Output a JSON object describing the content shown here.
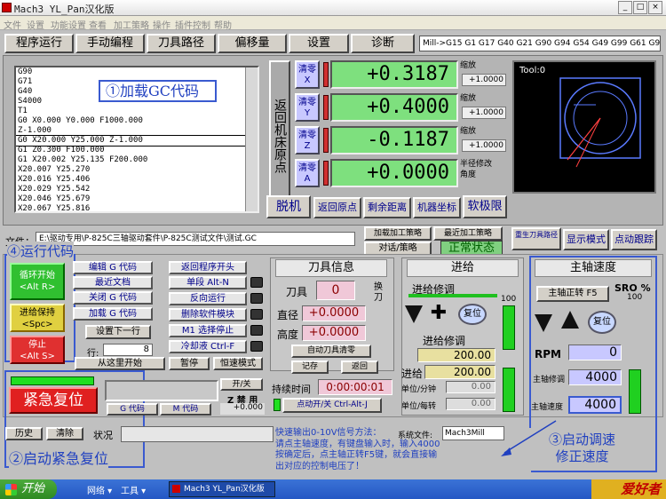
{
  "app": {
    "title": "Mach3 YL_Pan汉化版",
    "taskbar_title": "Mach3 YL_Pan汉化版"
  },
  "menu": [
    "文件",
    "设置",
    "功能设置",
    "查看",
    "加工策略",
    "操作",
    "插件控制",
    "帮助"
  ],
  "tabs": [
    "程序运行",
    "手动编程",
    "刀具路径",
    "偏移量",
    "设置",
    "诊断"
  ],
  "modal_line": "Mill->G15  G1 G17 G40 G21 G90 G94 G54 G49 G99 G61 G97",
  "gcode": [
    "G90",
    "G71",
    "G40",
    "S4000",
    "T1",
    "G0 X0.000 Y0.000 F1000.000",
    " Z-1.000",
    "G0 X20.000 Y25.000 Z-1.000",
    "G1   Z0.300 F100.000",
    "G1 X20.002 Y25.135  F200.000",
    "X20.007 Y25.270",
    "X20.016 Y25.406",
    "X20.029 Y25.542",
    "X20.046 Y25.679",
    "X20.067 Y25.816",
    "X20.091 Y25.953"
  ],
  "gcode_highlight": 7,
  "axes": [
    {
      "zero": "清零\nX",
      "value": "+0.3187",
      "scale_label": "缩放",
      "scale": "+1.0000"
    },
    {
      "zero": "清零\nY",
      "value": "+0.4000",
      "scale_label": "缩放",
      "scale": "+1.0000"
    },
    {
      "zero": "清零\nZ",
      "value": "-0.1187",
      "scale_label": "缩放",
      "scale": "+1.0000"
    },
    {
      "zero": "清零\nA",
      "value": "+0.0000",
      "scale_label": "半径修改\n角度",
      "scale": ""
    }
  ],
  "ref_all": "返回机床原点",
  "dro_buttons": [
    "脱机",
    "返回原点",
    "剩余距离",
    "机器坐标",
    "软极限"
  ],
  "toolpath": {
    "label": "Tool:0"
  },
  "file": {
    "label": "文件：",
    "path": "E:\\驱动专用\\P-825C三轴驱动套件\\P-825C测试文件\\测试.GC"
  },
  "strategy": {
    "b1": "加载加工策略",
    "b2": "最近加工策略",
    "b3": "对话/策略",
    "status": "正常状态"
  },
  "right_top": {
    "b1": "重生刀具路径",
    "b2": "显示模式",
    "b3": "点动跟踪"
  },
  "cycle": {
    "start": "循环开始\n<Alt R>",
    "hold": "进给保持\n<Spc>",
    "stop": "停止\n<Alt S>"
  },
  "prog": {
    "edit": "编辑 G 代码",
    "recent": "最近文档",
    "close": "关闭 G 代码",
    "load": "加载 G 代码",
    "next": "设置下一行",
    "line_label": "行:",
    "line_value": "8",
    "from_here": "从这里开始",
    "pause": "暂停",
    "const_speed": "恒速模式"
  },
  "middle": {
    "rewind": "返回程序开头",
    "single": "单段 Alt-N",
    "reverse": "反向运行",
    "block_del": "删除软件模块",
    "m1": "M1 选择停止",
    "coolant": "冷却液 Ctrl-F"
  },
  "tool": {
    "title": "刀具信息",
    "tool_label": "刀具",
    "tool_value": "0",
    "change": "换\n刀",
    "dia_label": "直径",
    "dia_value": "+0.0000",
    "h_label": "高度",
    "h_value": "+0.0000",
    "auto": "自动刀具清零",
    "remember": "记存",
    "return": "返回",
    "time_label": "持续时间",
    "time_value": "0:00:00:01",
    "jog": "点动开/关 Ctrl-Alt-J"
  },
  "feed": {
    "title": "进给",
    "override": "进给修调",
    "reset": "复位",
    "ov_value": "200.00",
    "ov2_label": "进给修调",
    "pct": "100",
    "feed_label": "进给",
    "feed_value": "200.00",
    "upm_label": "单位/分钟",
    "upm_value": "0.00",
    "upr_label": "单位/每转",
    "upr_value": "0.00"
  },
  "spindle": {
    "title": "主轴速度",
    "cw": "主轴正转 F5",
    "sro": "SRO %",
    "sro_value": "100",
    "reset": "复位",
    "rpm_label": "RPM",
    "rpm_value": "0",
    "ov_label": "主轴修调",
    "ov_value": "4000",
    "speed_label": "主轴速度",
    "speed_value": "4000"
  },
  "estop": {
    "label": "紧急复位",
    "on_off": "开/关",
    "z_label": "Z 禁 用",
    "z_value": "+0.000",
    "g_codes": "G 代码",
    "m_codes": "M 代码"
  },
  "bottom": {
    "history": "历史",
    "clear": "清除",
    "status_label": "状况",
    "sys_label": "系统文件:",
    "sys_value": "Mach3Mill"
  },
  "notes": {
    "n1": "①加载GC代码",
    "n2": "②启动紧急复位",
    "n3": "③启动调速\n修正速度",
    "n4": "④运行代码",
    "help": "快速输出0-10V信号方法：\n请点主轴速度，有键盘输入时，输入4000\n按确定后，点主轴正转F5键，就会直接输\n出对应的控制电压了！"
  },
  "taskbar": {
    "start": "开始",
    "net": "网络 ▾",
    "tools": "工具 ▾",
    "watermark": "爱好者"
  }
}
